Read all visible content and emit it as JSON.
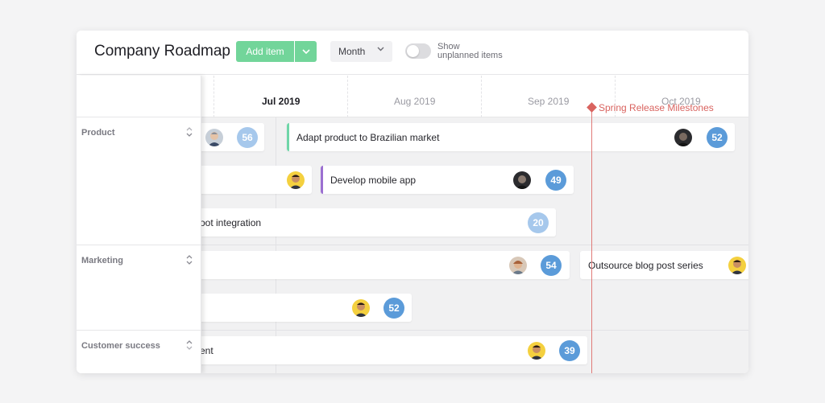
{
  "header": {
    "title": "Company Roadmap",
    "add_button_label": "Add item",
    "view_select": "Month",
    "toggle_label_line1": "Show",
    "toggle_label_line2": "unplanned items",
    "toggle_on": false
  },
  "timeline": {
    "months": [
      {
        "label": "Jul 2019",
        "current": true
      },
      {
        "label": "Aug 2019",
        "current": false
      },
      {
        "label": "Sep 2019",
        "current": false
      },
      {
        "label": "Oct 2019",
        "current": false
      }
    ],
    "milestone": {
      "label": "Spring Release Milestones",
      "color": "#d9635f"
    }
  },
  "groups": [
    {
      "label": "Product"
    },
    {
      "label": "Marketing"
    },
    {
      "label": "Customer success"
    }
  ],
  "items": [
    {
      "label": "",
      "score": "56"
    },
    {
      "label": "Adapt product to Brazilian market",
      "score": "52",
      "accent": "#6fd6a8"
    },
    {
      "label": "",
      "score": ""
    },
    {
      "label": "Develop mobile app",
      "score": "49",
      "accent": "#9b6fd1"
    },
    {
      "label": "oot integration",
      "score": "20"
    },
    {
      "label": "",
      "score": "54"
    },
    {
      "label": "Outsource blog post series",
      "score": ""
    },
    {
      "label": "",
      "score": "52"
    },
    {
      "label": "ent",
      "score": "39"
    }
  ],
  "colors": {
    "accent_green": "#72d59a",
    "score_blue": "#5b9bd9",
    "score_blue_light": "#a6c8ec",
    "milestone_red": "#d9635f"
  }
}
